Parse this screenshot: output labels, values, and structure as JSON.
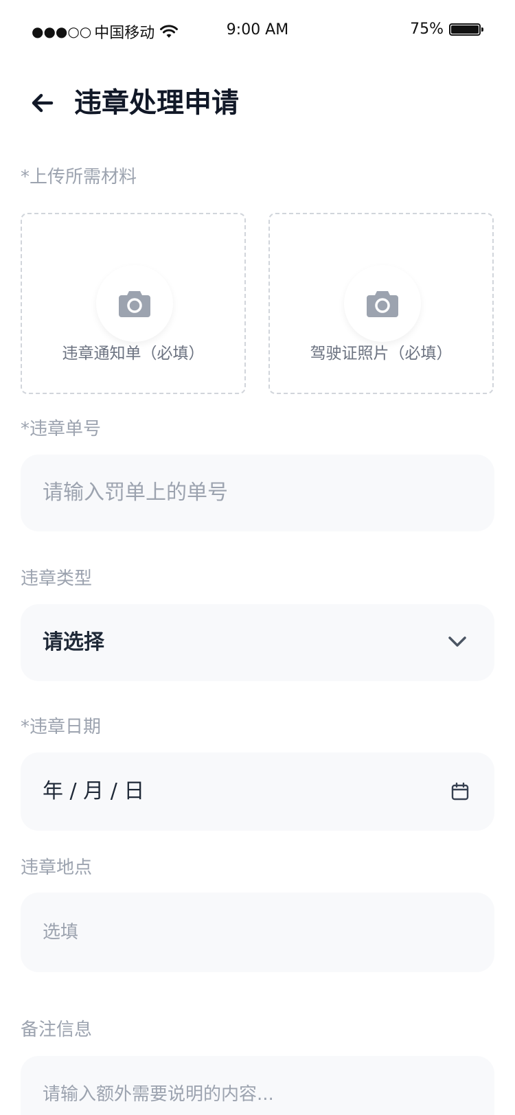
{
  "status_bar": {
    "signal": "●●●○○",
    "carrier": "中国移动",
    "time": "9:00 AM",
    "battery": "75%"
  },
  "header": {
    "title": "违章处理申请"
  },
  "upload": {
    "label": "*上传所需材料",
    "items": [
      {
        "label": "违章通知单（必填）"
      },
      {
        "label": "驾驶证照片（必填）"
      }
    ]
  },
  "fields": {
    "ticket_no": {
      "label": "*违章单号",
      "placeholder": "请输入罚单上的单号"
    },
    "type": {
      "label": "违章类型",
      "value": "请选择"
    },
    "date": {
      "label": "*违章日期",
      "value": "年 / 月 / 日"
    },
    "location": {
      "label": "违章地点",
      "placeholder": "选填"
    },
    "notes": {
      "label": "备注信息",
      "placeholder": "请输入额外需要说明的内容..."
    }
  },
  "colors": {
    "label": "#9ca3af",
    "field_bg": "#f8f9fb",
    "title": "#111827",
    "camera_icon": "#9ca3af"
  }
}
